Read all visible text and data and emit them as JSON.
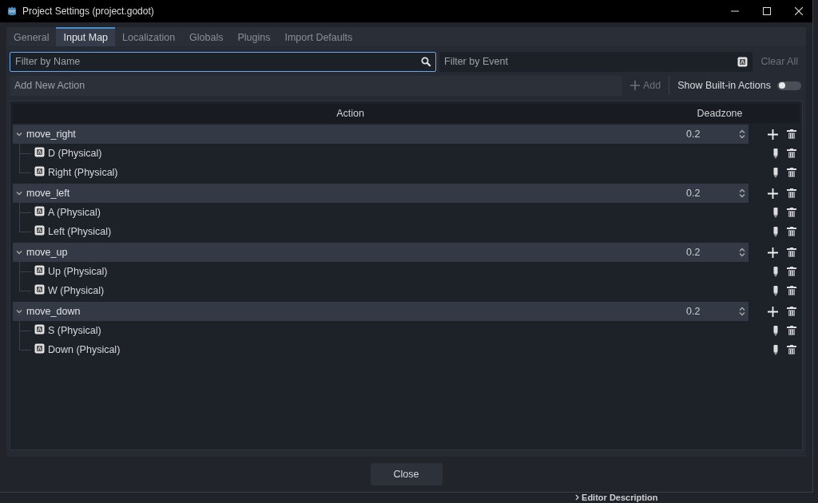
{
  "window": {
    "title": "Project Settings (project.godot)"
  },
  "tabs": [
    {
      "label": "General",
      "selected": false
    },
    {
      "label": "Input Map",
      "selected": true
    },
    {
      "label": "Localization",
      "selected": false
    },
    {
      "label": "Globals",
      "selected": false
    },
    {
      "label": "Plugins",
      "selected": false
    },
    {
      "label": "Import Defaults",
      "selected": false
    }
  ],
  "filter_by_name": {
    "placeholder": "Filter by Name"
  },
  "filter_by_event": {
    "placeholder": "Filter by Event"
  },
  "clear_all": {
    "label": "Clear All",
    "disabled": true
  },
  "new_action": {
    "placeholder": "Add New Action"
  },
  "add_button": {
    "label": "Add",
    "disabled": true
  },
  "show_builtin": {
    "label": "Show Built-in Actions",
    "on": false
  },
  "table": {
    "columns": [
      "Action",
      "Deadzone"
    ],
    "actions": [
      {
        "name": "move_right",
        "expanded": true,
        "deadzone": "0.2",
        "events": [
          "D (Physical)",
          "Right (Physical)"
        ]
      },
      {
        "name": "move_left",
        "expanded": true,
        "deadzone": "0.2",
        "events": [
          "A (Physical)",
          "Left (Physical)"
        ]
      },
      {
        "name": "move_up",
        "expanded": true,
        "deadzone": "0.2",
        "events": [
          "Up (Physical)",
          "W (Physical)"
        ]
      },
      {
        "name": "move_down",
        "expanded": true,
        "deadzone": "0.2",
        "events": [
          "S (Physical)",
          "Down (Physical)"
        ]
      }
    ]
  },
  "close_button": {
    "label": "Close"
  },
  "background_editor": {
    "section": "Editor Description"
  }
}
